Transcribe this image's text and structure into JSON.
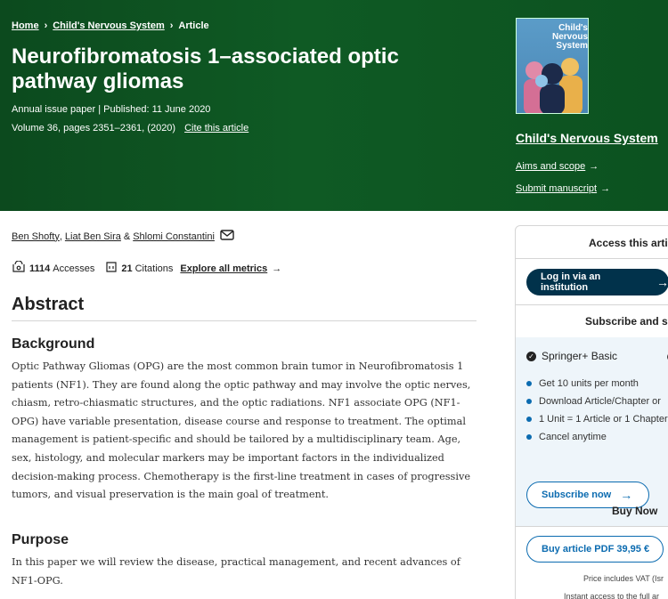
{
  "breadcrumb": {
    "home": "Home",
    "journal": "Child's Nervous System",
    "current": "Article",
    "separator": "›"
  },
  "article": {
    "title": "Neurofibromatosis 1–associated optic pathway gliomas",
    "meta_line1": "Annual issue paper | Published: 11 June 2020",
    "meta_line2": "Volume 36, pages 2351–2361, (2020)",
    "cite_link": "Cite this article"
  },
  "journal": {
    "cover_title_l1": "Child's",
    "cover_title_l2": "Nervous",
    "cover_title_l3": "System",
    "name": "Child's Nervous System",
    "aims_scope": "Aims and scope",
    "submit": "Submit manuscript",
    "arrow": "→"
  },
  "authors": {
    "a1": "Ben Shofty",
    "a2": "Liat Ben Sira",
    "a3": "Shlomi Constantini",
    "sep1": ",",
    "sep2": "&"
  },
  "metrics": {
    "accesses_count": "1114",
    "accesses_label": "Accesses",
    "citations_count": "21",
    "citations_label": "Citations",
    "explore": "Explore all metrics",
    "arrow": "→"
  },
  "abstract": {
    "heading": "Abstract",
    "background_heading": "Background",
    "background_text": "Optic Pathway Gliomas (OPG) are the most common brain tumor in Neurofibromatosis 1 patients (NF1). They are found along the optic pathway and may involve the optic nerves, chiasm, retro-chiasmatic structures, and the optic radiations. NF1 associate OPG (NF1-OPG) have variable presentation, disease course and response to treatment. The optimal management is patient-specific and should be tailored by a multidisciplinary team. Age, sex, histology, and molecular markers may be important factors in the individualized decision-making process. Chemotherapy is the first-line treatment in cases of progressive tumors, and visual preservation is the main goal of treatment.",
    "purpose_heading": "Purpose",
    "purpose_text": "In this paper we will review the disease, practical management, and recent advances of NF1-OPG."
  },
  "sidebar": {
    "access_heading": "Access this artic",
    "login_button": "Log in via an institution",
    "arrow": "→",
    "subscribe_heading": "Subscribe and sa",
    "plan_name": "Springer+ Basic",
    "plan_bullets": [
      "Get 10 units per month",
      "Download Article/Chapter or",
      "1 Unit = 1 Article or 1 Chapter",
      "Cancel anytime"
    ],
    "subscribe_button": "Subscribe now",
    "buy_heading": "Buy Now",
    "buy_button": "Buy article PDF 39,95 €",
    "vat_note": "Price includes VAT (Isr",
    "instant_note": "Instant access to the full ar"
  }
}
